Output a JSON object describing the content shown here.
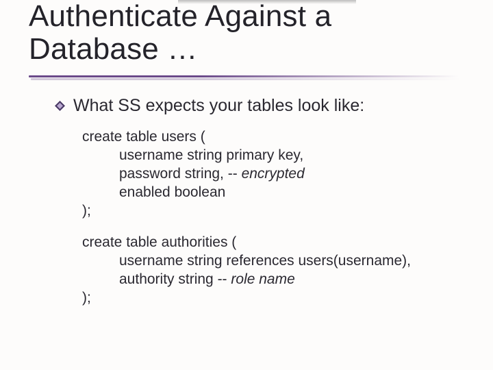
{
  "title": "Authenticate Against a Database …",
  "bullet": "What SS expects your tables look like:",
  "users_block": {
    "open": "create table users (",
    "l1_a": "username string primary key,",
    "l2_a": "password string, -- ",
    "l2_b": "encrypted",
    "l3_a": "enabled boolean",
    "close": ");"
  },
  "auth_block": {
    "open": "create table authorities (",
    "l1_a": "username string references users(username),",
    "l2_a": "authority string -- ",
    "l2_b": "role name",
    "close": ");"
  }
}
